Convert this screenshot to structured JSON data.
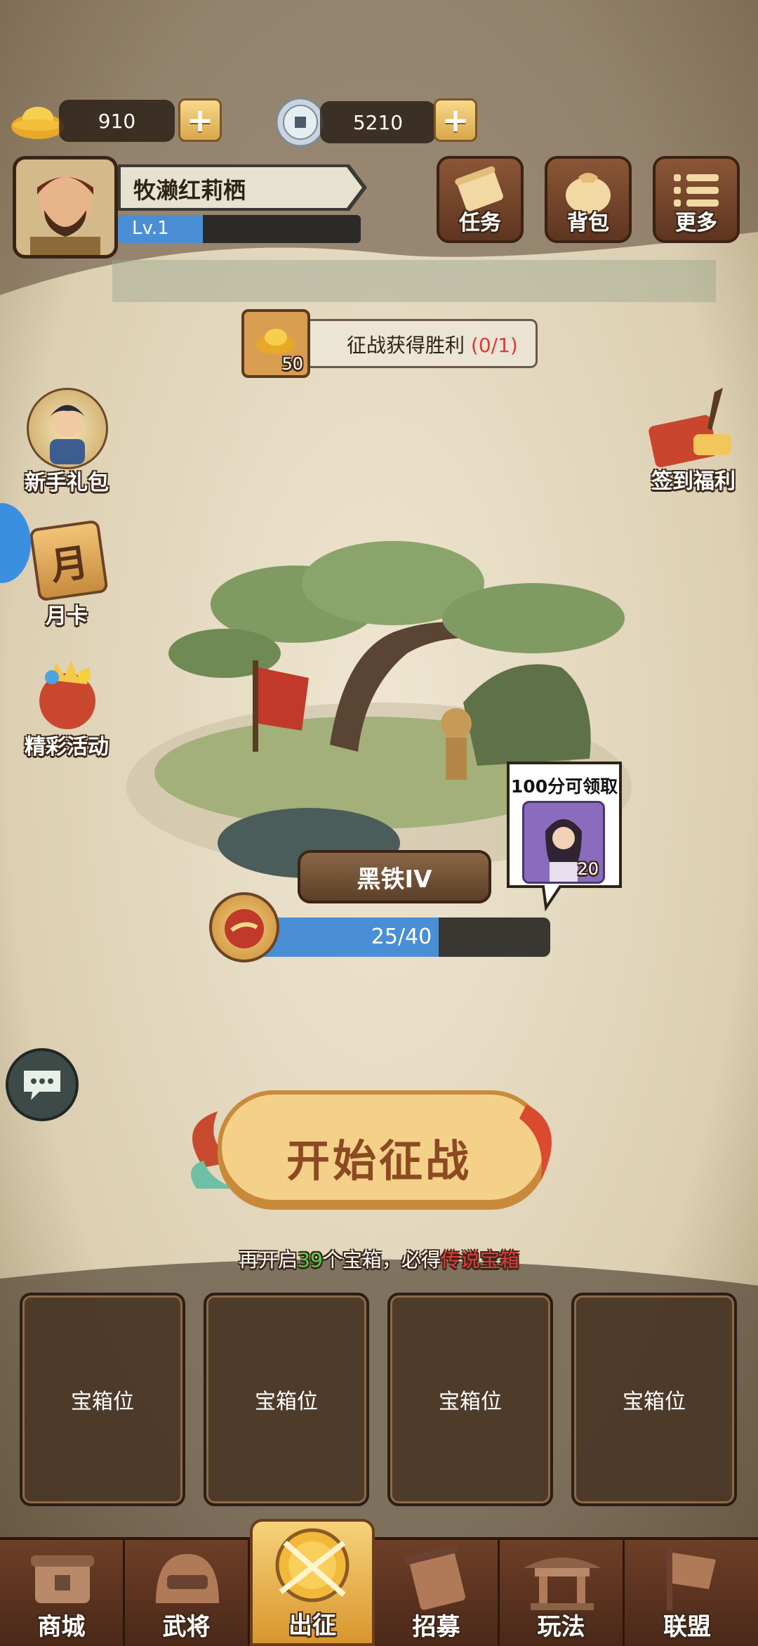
{
  "currency": {
    "gold_value": "910",
    "coin_value": "5210",
    "gold_icon": "gold-ingot-icon",
    "coin_icon": "copper-coin-icon"
  },
  "player": {
    "name": "牧濑红莉栖",
    "level": "Lv.1",
    "exp_progress": 0.35
  },
  "top_buttons": [
    {
      "label": "任务",
      "icon": "scroll-icon"
    },
    {
      "label": "背包",
      "icon": "bag-icon"
    },
    {
      "label": "更多",
      "icon": "menu-icon"
    }
  ],
  "quest": {
    "reward_amount": "50",
    "text": "征战获得胜利",
    "progress": "(0/1)"
  },
  "left_side": [
    {
      "label": "新手礼包"
    },
    {
      "label": "月卡",
      "glyph": "月"
    },
    {
      "label": "精彩活动"
    }
  ],
  "right_side": [
    {
      "label": "签到福利"
    }
  ],
  "rank": {
    "name": "黑铁IV",
    "progress_text": "25/40",
    "progress": 0.625
  },
  "reward_bubble": {
    "title": "100分可领取",
    "count": "20"
  },
  "start_button": {
    "label": "开始征战"
  },
  "chest_hint": {
    "prefix": "再开启",
    "count": "39",
    "middle": "个宝箱，必得",
    "highlight": "传说宝箱"
  },
  "chest_slots": [
    "宝箱位",
    "宝箱位",
    "宝箱位",
    "宝箱位"
  ],
  "bottom_nav": [
    {
      "label": "商城",
      "active": false
    },
    {
      "label": "武将",
      "active": false
    },
    {
      "label": "出征",
      "active": true
    },
    {
      "label": "招募",
      "active": false
    },
    {
      "label": "玩法",
      "active": false
    },
    {
      "label": "联盟",
      "active": false
    }
  ],
  "colors": {
    "accent_gold": "#f2c46a",
    "progress_blue": "#4a8fd6",
    "hint_green": "#4fd14a",
    "hint_red": "#e23a3a"
  }
}
